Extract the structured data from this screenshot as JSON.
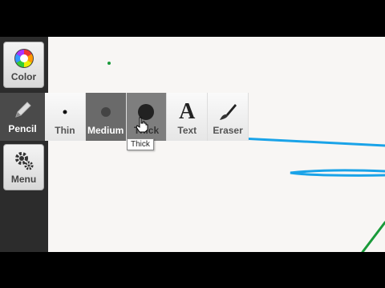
{
  "sidebar": {
    "color_label": "Color",
    "pencil_label": "Pencil",
    "menu_label": "Menu"
  },
  "tools": {
    "thin": "Thin",
    "medium": "Medium",
    "thick": "Thick",
    "text": "Text",
    "text_glyph": "A",
    "eraser": "Eraser"
  },
  "tooltip": "Thick",
  "colors": {
    "stroke_blue": "#1aa3e8",
    "stroke_green": "#1a9a3a",
    "sidebar_bg": "#2c2c2c",
    "selected_tool": "#6a6a6a"
  },
  "selected": {
    "tool": "Pencil",
    "size": "Medium"
  }
}
